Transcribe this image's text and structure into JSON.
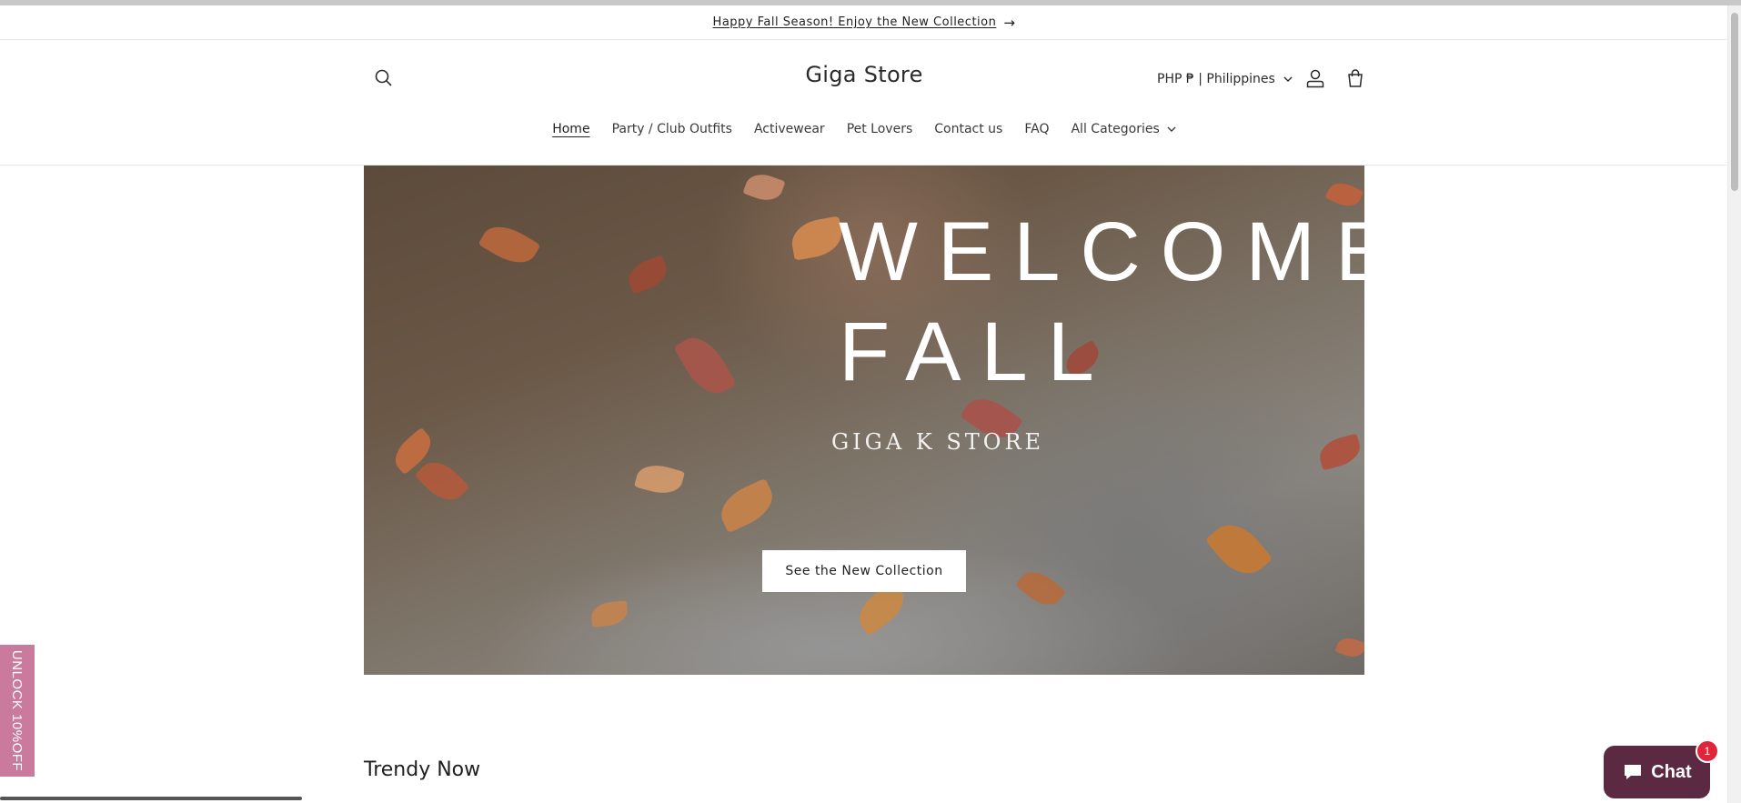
{
  "announcement": {
    "text": "Happy Fall Season! Enjoy the New Collection",
    "arrow_icon": "arrow-right-icon"
  },
  "header": {
    "logo": "Giga Store",
    "locale": "PHP ₱ | Philippines",
    "icons": {
      "search": "search-icon",
      "account": "account-icon",
      "cart": "cart-icon"
    }
  },
  "nav": {
    "items": [
      {
        "label": "Home",
        "active": true
      },
      {
        "label": "Party / Club Outfits"
      },
      {
        "label": "Activewear"
      },
      {
        "label": "Pet Lovers"
      },
      {
        "label": "Contact us"
      },
      {
        "label": "FAQ"
      },
      {
        "label": "All Categories",
        "dropdown": true
      }
    ]
  },
  "hero": {
    "title_line1": "WELCOME",
    "title_line2": "FALL",
    "subtitle": "GIGA K STORE",
    "cta": "See the New Collection"
  },
  "sections": {
    "trendy_title": "Trendy Now"
  },
  "promo_tab": {
    "label": "UNLOCK 10%OFF",
    "color": "#c97a9d"
  },
  "chat": {
    "label": "Chat",
    "badge": "1",
    "color": "#5b2a42"
  }
}
